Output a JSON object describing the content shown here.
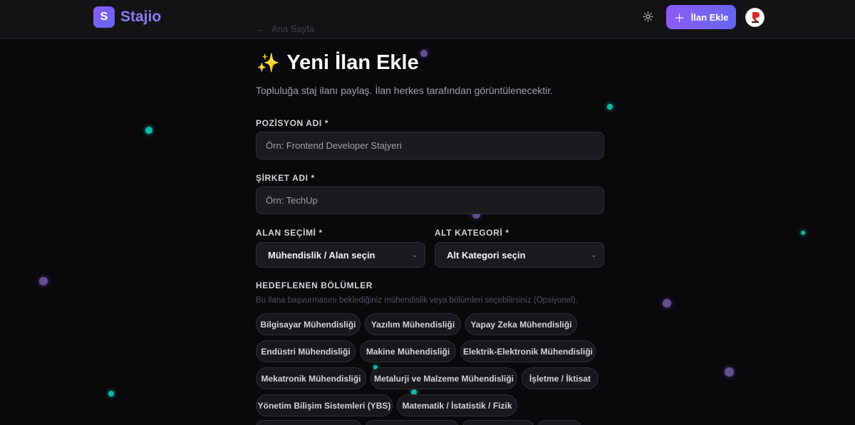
{
  "header": {
    "logo_letter": "S",
    "logo_text": "Stajio",
    "add_button_label": "İlan Ekle",
    "avatar_alt": "profile"
  },
  "back_link": {
    "label": "Ana Sayfa"
  },
  "main": {
    "title": "Yeni İlan Ekle",
    "title_emoji": "✨",
    "subtitle": "Topluluğa staj ilanı paylaş. İlan herkes tarafından görüntülenecektir."
  },
  "form": {
    "position": {
      "label": "POZİSYON ADI *",
      "placeholder": "Örn: Frontend Developer Stajyeri",
      "value": ""
    },
    "company": {
      "label": "ŞİRKET ADI *",
      "placeholder": "Örn: TechUp",
      "value": ""
    },
    "field": {
      "label": "ALAN SEÇİMİ *",
      "selected": "Mühendislik / Alan seçin"
    },
    "subcategory": {
      "label": "ALT KATEGORİ *",
      "selected": "Alt Kategori seçin"
    },
    "departments": {
      "label": "HEDEFLENEN BÖLÜMLER",
      "hint": "Bu ilana başvurmasını beklediğiniz mühendislik veya bölümleri seçebilirsiniz (Opsiyonel).",
      "chips": [
        "Bilgisayar Mühendisliği",
        "Yazılım Mühendisliği",
        "Yapay Zeka Mühendisliği",
        "Endüstri Mühendisliği",
        "Makine Mühendisliği",
        "Elektrik-Elektronik Mühendisliği",
        "Mekatronik Mühendisliği",
        "Metalurji ve Malzeme Mühendisliği",
        "İşletme / İktisat",
        "Yönetim Bilişim Sistemleri (YBS)",
        "Matematik / İstatistik / Fizik"
      ]
    }
  },
  "colors": {
    "background": "#09090b",
    "accent": "#8b5cf6",
    "accent_secondary": "#6366f1",
    "particle_teal": "#14b8a6"
  },
  "icons": {
    "theme": "sun-icon",
    "add": "plus-icon",
    "back": "arrow-left-icon",
    "chevron": "chevron-down-icon"
  }
}
